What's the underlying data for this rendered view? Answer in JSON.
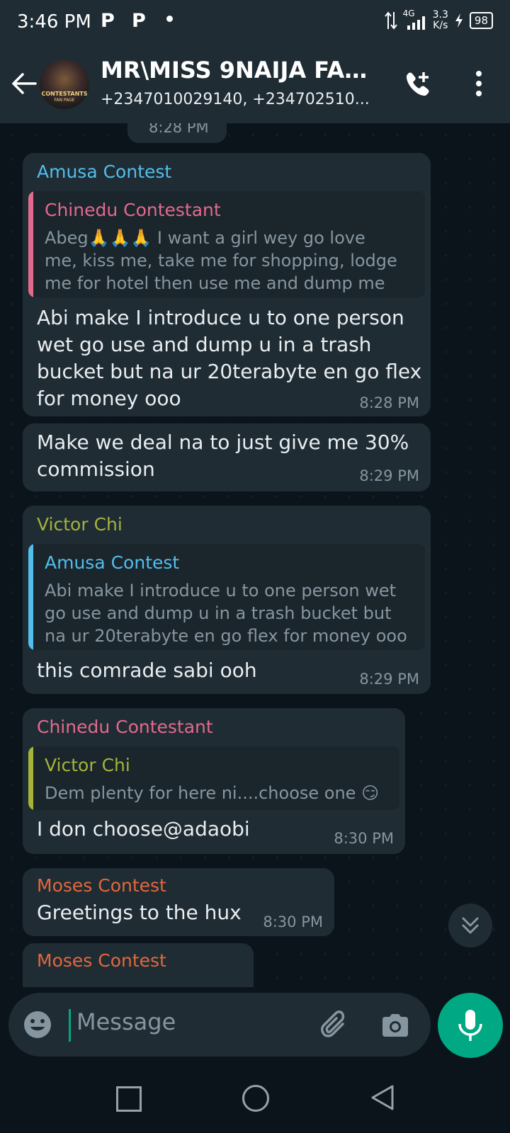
{
  "status_bar": {
    "time": "3:46 PM",
    "app_badge_1": "P",
    "app_badge_2": "P",
    "network": "4G",
    "speed_value": "3.3",
    "speed_unit": "K/s",
    "battery": "98"
  },
  "header": {
    "title": "MR\\MISS 9NAIJA FAN...",
    "subtitle": "+2347010029140, +234702510...",
    "avatar_text_1": "CONTESTANTS",
    "avatar_text_2": "FAN PAGE"
  },
  "messages": [
    {
      "time": "8:28 PM"
    },
    {
      "sender": "Amusa Contest",
      "sender_color": "#53bdeb",
      "quote": {
        "name": "Chinedu Contestant",
        "color": "#e26a8d",
        "lines": [
          "Abeg🙏🙏🙏 I want a girl wey go love",
          "me, kiss me, take me for shopping, lodge",
          "me for hotel then use me and dump me"
        ]
      },
      "lines": [
        "Abi make I introduce u to one person",
        "wet go use and dump u in a trash",
        "bucket but na ur 20terabyte en go flex",
        "for money ooo"
      ],
      "time": "8:28 PM"
    },
    {
      "lines": [
        "Make we deal na to just give me 30%",
        "commission"
      ],
      "time": "8:29 PM"
    },
    {
      "sender": "Victor Chi",
      "sender_color": "#a6b33a",
      "quote": {
        "name": "Amusa Contest",
        "color": "#53bdeb",
        "lines": [
          "Abi make I introduce u to one person wet",
          "go use and dump u in a trash bucket but",
          "na ur 20terabyte en go flex for money ooo"
        ]
      },
      "lines": [
        "this comrade sabi ooh"
      ],
      "time": "8:29 PM"
    },
    {
      "sender": "Chinedu Contestant",
      "sender_color": "#e26a8d",
      "quote": {
        "name": "Victor Chi",
        "color": "#a6b33a",
        "lines": [
          "Dem plenty for here ni....choose one 😏"
        ]
      },
      "lines": [
        "I don choose@adaobi"
      ],
      "time": "8:30 PM"
    },
    {
      "sender": "Moses Contest",
      "sender_color": "#e2683c",
      "lines": [
        "Greetings to the hux"
      ],
      "time": "8:30 PM"
    },
    {
      "sender": "Moses Contest",
      "sender_color": "#e2683c"
    }
  ],
  "input": {
    "placeholder": "Message"
  },
  "colors": {
    "accent": "#00a884",
    "bubble": "#1f2c34",
    "background": "#0b141a"
  }
}
